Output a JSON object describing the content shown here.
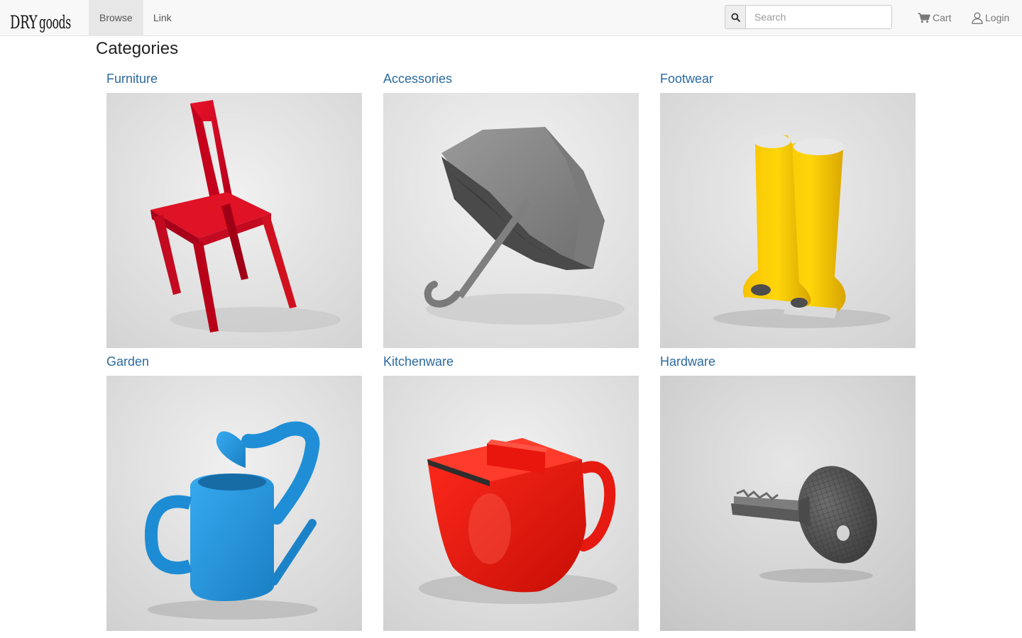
{
  "brand": {
    "part1": "DRY",
    "part2": "goods"
  },
  "nav": {
    "browse": "Browse",
    "link": "Link"
  },
  "search": {
    "placeholder": "Search"
  },
  "actions": {
    "cart": "Cart",
    "login": "Login"
  },
  "page": {
    "title": "Categories"
  },
  "categories": [
    {
      "label": "Furniture",
      "image": "red-chair"
    },
    {
      "label": "Accessories",
      "image": "concrete-umbrella"
    },
    {
      "label": "Footwear",
      "image": "yellow-open-toe-boots"
    },
    {
      "label": "Garden",
      "image": "blue-watering-can"
    },
    {
      "label": "Kitchenware",
      "image": "red-teapot"
    },
    {
      "label": "Hardware",
      "image": "key-on-round-handle"
    }
  ],
  "colors": {
    "link": "#2c6aa0",
    "navbar_bg": "#f8f8f8",
    "active_nav_bg": "#e7e7e7"
  }
}
